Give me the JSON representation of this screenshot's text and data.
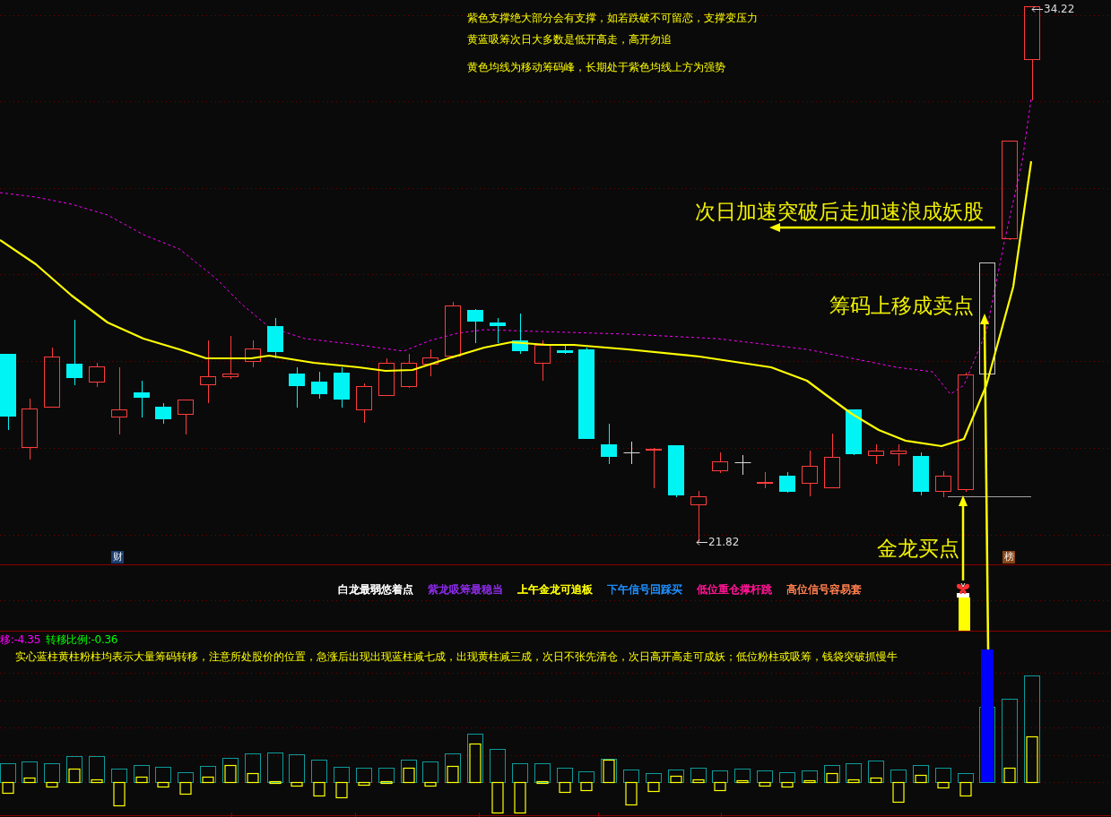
{
  "price_panel": {
    "notes": [
      "紫色支撑绝大部分会有支撑，如若跌破不可留恋，支撑变压力",
      "黄蓝吸筹次日大多数是低开高走，高开勿追",
      "黄色均线为移动筹码峰，长期处于紫色均线上方为强势"
    ],
    "high_label": "34.22",
    "low_label": "21.82",
    "callouts": [
      "次日加速突破后走加速浪成妖股",
      "筹码上移成卖点",
      "金龙买点"
    ],
    "tags": [
      {
        "text": "财",
        "color": "#1c3d6e"
      },
      {
        "text": "榜",
        "color": "#8a4514"
      }
    ]
  },
  "signal_panel": {
    "signals": [
      {
        "label": "白龙最弱悠着点",
        "color": "#ffffff"
      },
      {
        "label": "紫龙吸筹最稳当",
        "color": "#8a2be2"
      },
      {
        "label": "上午金龙可追板",
        "color": "#ffff00"
      },
      {
        "label": "下午信号回踩买",
        "color": "#1e90ff"
      },
      {
        "label": "低位重仓撑杆跳",
        "color": "#ff1493"
      },
      {
        "label": "高位信号容易套",
        "color": "#ff7f50"
      }
    ]
  },
  "indicator_panel": {
    "readouts": [
      {
        "label": "移:-4.35",
        "color": "#ff00ff"
      },
      {
        "label": "转移比例:-0.36",
        "color": "#00ff00"
      }
    ],
    "description": "实心蓝柱黄柱粉柱均表示大量筹码转移，注意所处股价的位置，急涨后出现出现蓝柱减七成，出现黄柱减三成，次日不张先清仓，次日高开高走可成妖；低位粉柱或吸筹，钱袋突破抓慢牛"
  }
}
